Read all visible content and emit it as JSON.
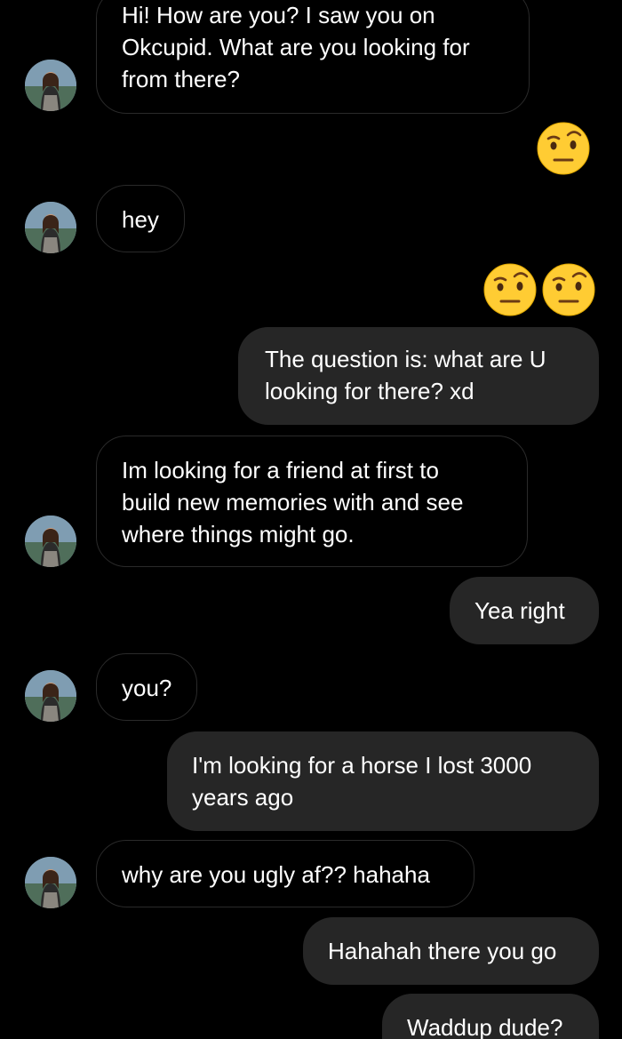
{
  "messages": [
    {
      "from": "them",
      "text": "Hi! How are you? I saw you on\nOkcupid. What are you looking for\nfrom there?"
    },
    {
      "from": "me",
      "emoji": [
        "face-with-raised-eyebrow"
      ]
    },
    {
      "from": "them",
      "text": "hey"
    },
    {
      "from": "me",
      "emoji": [
        "face-with-raised-eyebrow",
        "face-with-raised-eyebrow"
      ]
    },
    {
      "from": "me",
      "text": "The question is: what are U\nlooking for there? xd"
    },
    {
      "from": "them",
      "text": "Im looking for a friend at first to\nbuild new memories with and see\nwhere things might go."
    },
    {
      "from": "me",
      "text": "Yea right"
    },
    {
      "from": "them",
      "text": "you?"
    },
    {
      "from": "me",
      "text": "I'm looking for a horse I lost 3000\nyears ago"
    },
    {
      "from": "them",
      "text": "why are you ugly af?? hahaha"
    },
    {
      "from": "me",
      "text": "Hahahah there you go"
    },
    {
      "from": "me",
      "text": "Waddup dude?"
    }
  ],
  "colors": {
    "background": "#000000",
    "outgoing_bubble": "#262626",
    "incoming_border": "#2a2a2a",
    "emoji_yellow": "#ffcc33"
  }
}
